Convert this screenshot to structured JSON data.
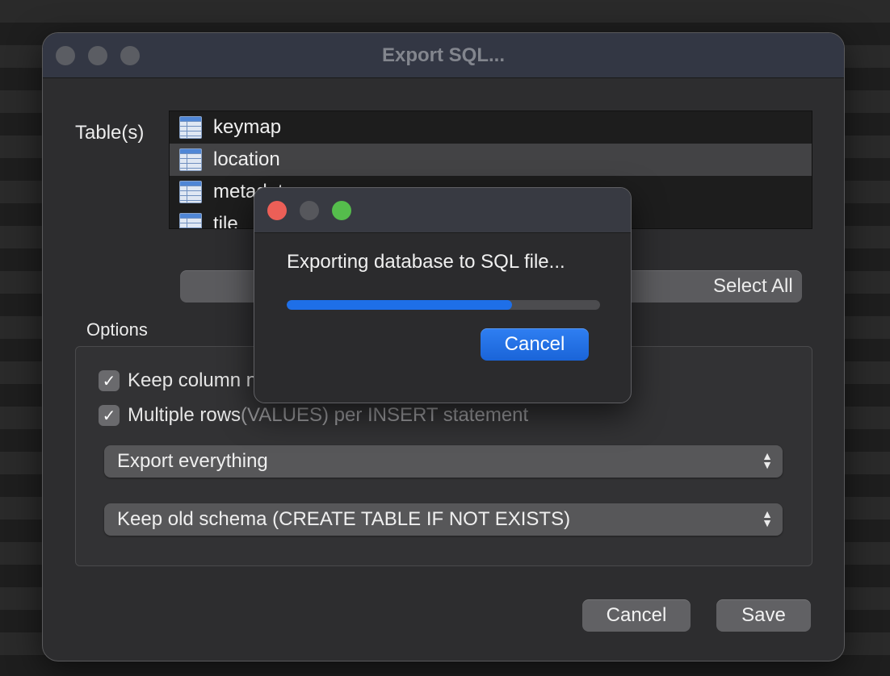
{
  "window": {
    "title": "Export SQL..."
  },
  "tables": {
    "label": "Table(s)",
    "items": [
      {
        "name": "keymap",
        "selected": false
      },
      {
        "name": "location",
        "selected": true
      },
      {
        "name": "metadata",
        "selected": false
      },
      {
        "name": "tile",
        "selected": false
      }
    ],
    "select_all_label": "Select All"
  },
  "options": {
    "label": "Options",
    "keep_column_names": {
      "label": "Keep column names in INSERT INTO",
      "checked": true
    },
    "multiple_rows": {
      "label_main": "Multiple rows ",
      "label_dim": "(VALUES) per INSERT statement",
      "checked": true
    },
    "export_mode": {
      "selected": "Export everything"
    },
    "schema_mode": {
      "selected": "Keep old schema (CREATE TABLE IF NOT EXISTS)"
    }
  },
  "footer": {
    "cancel_label": "Cancel",
    "save_label": "Save"
  },
  "progress_dialog": {
    "message": "Exporting database to SQL file...",
    "progress_fraction": 0.72,
    "cancel_label": "Cancel",
    "colors": {
      "close": "#ec5f57",
      "minimize": "#56575c",
      "zoom": "#55bd4c",
      "progress": "#1e6fe8"
    }
  }
}
